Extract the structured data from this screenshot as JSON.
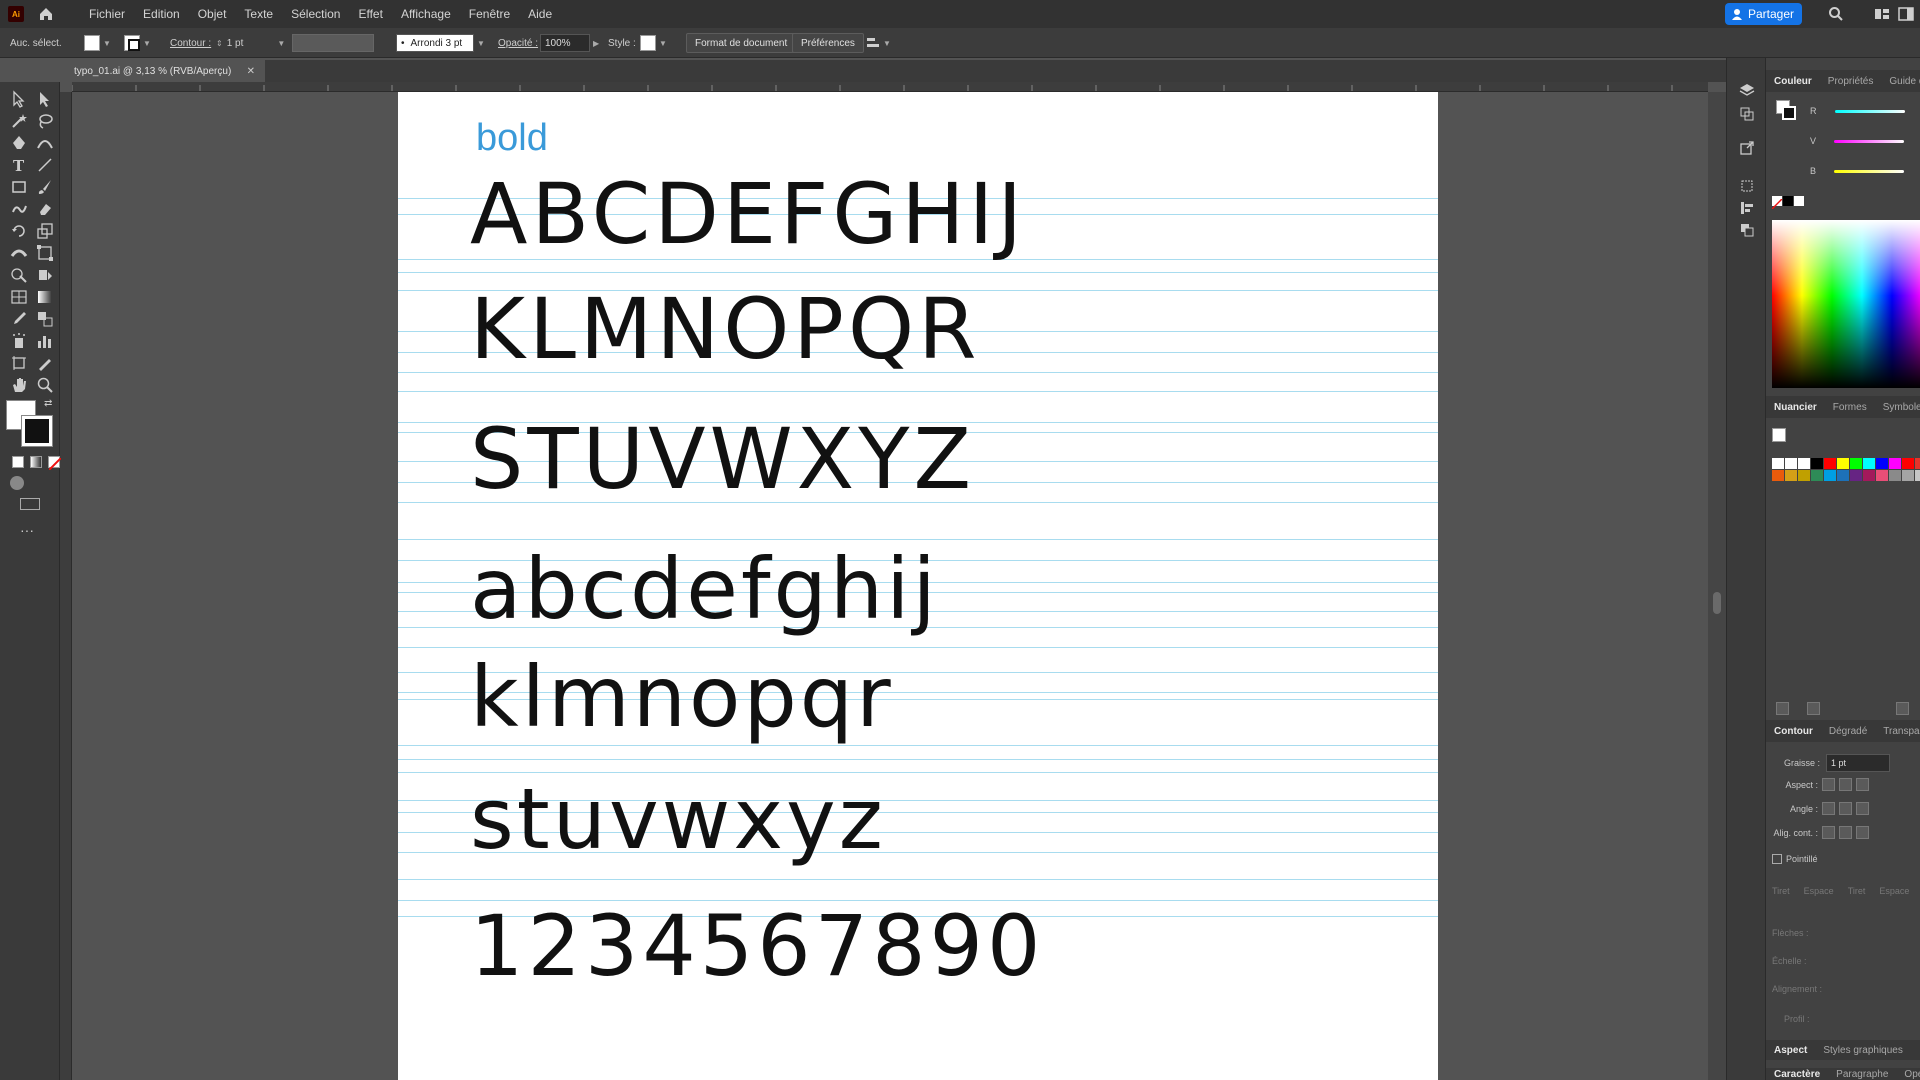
{
  "app": {
    "logo": "Ai",
    "menus": [
      "Fichier",
      "Edition",
      "Objet",
      "Texte",
      "Sélection",
      "Effet",
      "Affichage",
      "Fenêtre",
      "Aide"
    ],
    "share_label": "Partager"
  },
  "control_bar": {
    "selection_label": "Auc. sélect.",
    "contour_label": "Contour :",
    "stroke_weight": "1 pt",
    "brush_label": "Arrondi 3 pt",
    "opacity_label": "Opacité :",
    "opacity_value": "100%",
    "style_label": "Style :",
    "doc_format_button": "Format de document",
    "preferences_button": "Préférences"
  },
  "document": {
    "tab_title": "typo_01.ai @ 3,13 % (RVB/Aperçu)",
    "artboard": {
      "heading": "bold",
      "rows": [
        "ABCDEFGHIJ",
        "KLMNOPQR",
        "STUVWXYZ",
        "abcdefghij",
        "klmnopqr",
        "stuvwxyz",
        "1234567890"
      ]
    }
  },
  "panels": {
    "color_tabs": [
      "Couleur",
      "Propriétés",
      "Guide de"
    ],
    "color_sliders": [
      "R",
      "V",
      "B"
    ],
    "swatch_tabs": [
      "Nuancier",
      "Formes",
      "Symboles"
    ],
    "stroke_tabs": [
      "Contour",
      "Dégradé",
      "Transpar"
    ],
    "stroke": {
      "weight_label": "Graisse :",
      "weight_value": "1 pt",
      "cap_label": "Aspect :",
      "corner_label": "Angle :",
      "align_label": "Alig. cont. :",
      "dashed_label": "Pointillé",
      "dash_labels": [
        "Tiret",
        "Espace",
        "Tiret",
        "Espace"
      ],
      "arrows_label": "Flèches :",
      "scale_label": "Échelle :",
      "alignment_label": "Alignement :",
      "profile_label": "Profil :"
    },
    "appearance_tabs": [
      "Aspect",
      "Styles graphiques"
    ],
    "character_tabs": [
      "Caractère",
      "Paragraphe",
      "Ope"
    ]
  },
  "colors": {
    "accent": "#1473e6",
    "guide": "#a8dcef",
    "heading": "#3a9ad9",
    "swatches": [
      "#ffffff",
      "#ffffff",
      "#ffffff",
      "#000000",
      "#ff0000",
      "#ffff00",
      "#00ff00",
      "#00ffff",
      "#0000ff",
      "#ff00ff",
      "#ff0000",
      "#e6332a",
      "#f39200",
      "#ffed00",
      "#95c11f",
      "#3aaa35",
      "#ea5b0c",
      "#d4a017",
      "#c0a000",
      "#2e8b57",
      "#009fe3",
      "#1d71b8",
      "#662483",
      "#a3195b",
      "#e94e77",
      "#8a8a8a",
      "#a4a4a4",
      "#c6c6c6",
      "#ddc79c",
      "#b8864e",
      "#8a5a2b",
      "#5e3a1a"
    ]
  }
}
